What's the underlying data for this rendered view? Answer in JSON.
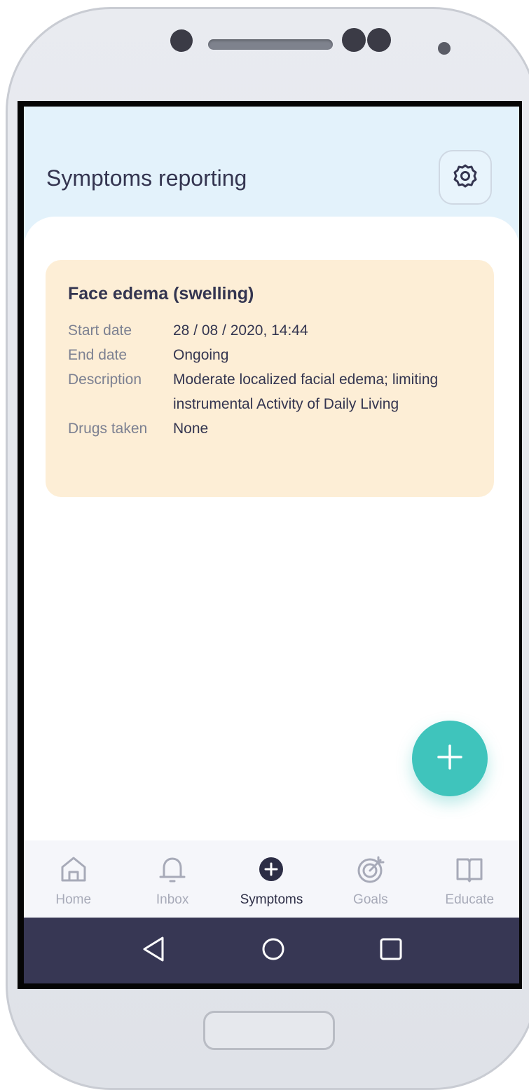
{
  "app": {
    "title": "Symptoms reporting"
  },
  "header": {
    "settings_icon": "gear-icon"
  },
  "symptom_card": {
    "title": "Face edema (swelling)",
    "fields": [
      {
        "label": "Start date",
        "value": "28 / 08 / 2020, 14:44"
      },
      {
        "label": "End date",
        "value": "Ongoing"
      },
      {
        "label": "Description",
        "value": "Moderate localized facial edema; limiting instrumental Activity of Daily Living"
      },
      {
        "label": "Drugs taken",
        "value": "None"
      }
    ]
  },
  "fab": {
    "icon": "plus-icon"
  },
  "nav": {
    "items": [
      {
        "label": "Home",
        "icon": "home-icon",
        "active": false
      },
      {
        "label": "Inbox",
        "icon": "bell-icon",
        "active": false
      },
      {
        "label": "Symptoms",
        "icon": "plus-circle-icon",
        "active": true
      },
      {
        "label": "Goals",
        "icon": "target-icon",
        "active": false
      },
      {
        "label": "Educate",
        "icon": "book-icon",
        "active": false
      }
    ]
  },
  "system_nav": {
    "back": "back-icon",
    "home": "circle-home-icon",
    "recents": "square-recents-icon"
  },
  "colors": {
    "header_bg": "#e3f2fb",
    "card_bg": "#fdeed6",
    "accent": "#3fc4bc",
    "text_dark": "#343550",
    "android_bar": "#373754"
  }
}
